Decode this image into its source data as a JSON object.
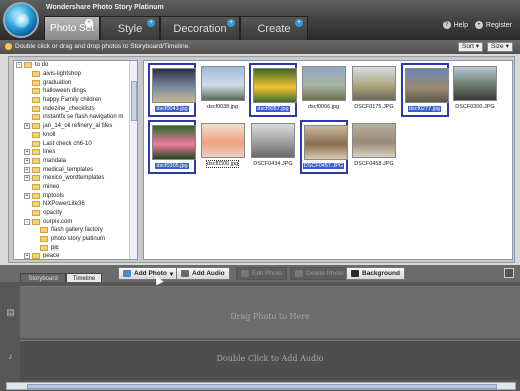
{
  "app": {
    "title": "Wondershare Photo Story Platinum",
    "help_label": "Help",
    "register_label": "Register"
  },
  "tabs": [
    {
      "label": "Photo Set",
      "active": true
    },
    {
      "label": "Style"
    },
    {
      "label": "Decoration"
    },
    {
      "label": "Create"
    }
  ],
  "hint": {
    "text": "Double click or drag and drop photos to Storyboard/Timeline.",
    "sort_label": "Sort",
    "size_label": "Size"
  },
  "tree": {
    "items": [
      {
        "label": "to do",
        "exp": "-",
        "indent": 0
      },
      {
        "label": "aivis-lightshop",
        "indent": 1
      },
      {
        "label": "graduation",
        "indent": 1
      },
      {
        "label": "halloween dings",
        "indent": 1
      },
      {
        "label": "happy Family children",
        "indent": 1
      },
      {
        "label": "indezine_checklists",
        "indent": 1
      },
      {
        "label": "instantfx se flash navigation m",
        "indent": 1
      },
      {
        "label": "jan_14_oil refinery_ai files",
        "exp": "+",
        "indent": 1
      },
      {
        "label": "knoll",
        "indent": 1
      },
      {
        "label": "Last check ch6-10",
        "indent": 1
      },
      {
        "label": "lines",
        "exp": "+",
        "indent": 1
      },
      {
        "label": "mandala",
        "exp": "+",
        "indent": 1
      },
      {
        "label": "medical_templates",
        "exp": "+",
        "indent": 1
      },
      {
        "label": "mexico_wordtemplates",
        "exp": "+",
        "indent": 1
      },
      {
        "label": "mineo",
        "indent": 1
      },
      {
        "label": "mptools",
        "exp": "+",
        "indent": 1
      },
      {
        "label": "NXPowerLite36",
        "indent": 1
      },
      {
        "label": "opacity",
        "indent": 1
      },
      {
        "label": "ourpix.com",
        "exp": "-",
        "indent": 1
      },
      {
        "label": "flash gallery factory",
        "indent": 2
      },
      {
        "label": "photo story platinum",
        "indent": 2
      },
      {
        "label": "pic",
        "indent": 2,
        "selected": true
      },
      {
        "label": "peace",
        "exp": "+",
        "indent": 1
      }
    ]
  },
  "photos": [
    {
      "name": "dscf0043.jpg",
      "selected": true,
      "colors": [
        "#2b3040",
        "#7a8aa0",
        "#c8b890"
      ]
    },
    {
      "name": "dscf0038.jpg",
      "colors": [
        "#9fb8d8",
        "#d0dcea",
        "#5a6a5a"
      ]
    },
    {
      "name": "dscf0057.jpg",
      "selected": true,
      "colors": [
        "#3c6a2a",
        "#f2c230",
        "#3a7030"
      ]
    },
    {
      "name": "dscf0066.jpg",
      "colors": [
        "#8ea7c4",
        "#a9b6a3",
        "#6a7050"
      ]
    },
    {
      "name": "DSCF0175.JPG",
      "colors": [
        "#d9dde3",
        "#b0a880",
        "#6a6a5a"
      ]
    },
    {
      "name": "dscf0277.jpg",
      "selected": true,
      "colors": [
        "#6a84b8",
        "#9c8c70",
        "#5a5a4a"
      ]
    },
    {
      "name": "DSCF0300.JPG",
      "colors": [
        "#b8c8d8",
        "#6a7a6a",
        "#3a3a3a"
      ]
    },
    {
      "name": "dscf0305.jpg",
      "selected": true,
      "colors": [
        "#2a6a2a",
        "#f07aa0",
        "#1e4a1e"
      ]
    },
    {
      "name": "dscf0306.jpg",
      "focus": true,
      "colors": [
        "#f0e0d0",
        "#f0a080",
        "#e8d0c0"
      ]
    },
    {
      "name": "DSCF0434.JPG",
      "colors": [
        "#d8ddd8",
        "#a0a0a0",
        "#6a6a6a"
      ]
    },
    {
      "name": "DSCF0457.JPG",
      "selected": true,
      "colors": [
        "#c8b8a0",
        "#8a7050",
        "#d8c8b0"
      ]
    },
    {
      "name": "DSCF0458.JPG",
      "colors": [
        "#b8b0a0",
        "#988878",
        "#d8d0c0"
      ]
    }
  ],
  "toolbar": {
    "storyboard_tab": "Storyboard",
    "timeline_tab": "Timeline",
    "add_photo": "Add Photo",
    "add_audio": "Add Audio",
    "edit_photo": "Edit Photo",
    "delete_photo": "Delete Photo",
    "background": "Background"
  },
  "storyboard": {
    "photo_msg": "Drag Photo to Here",
    "audio_msg": "Double Click to Add Audio"
  }
}
